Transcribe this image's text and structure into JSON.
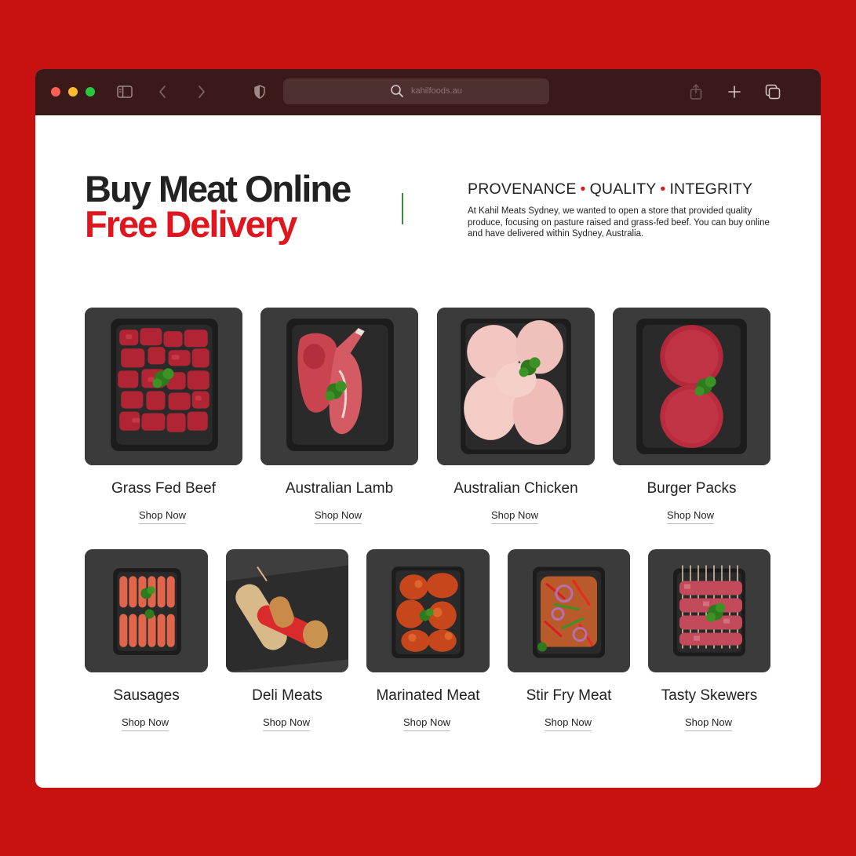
{
  "browser": {
    "url": "kahilfoods.au"
  },
  "hero": {
    "line1": "Buy Meat Online",
    "line2": "Free Delivery",
    "tagline": [
      "PROVENANCE",
      "QUALITY",
      "INTEGRITY"
    ],
    "intro": "At Kahil Meats Sydney, we wanted to open a store that provided quality produce, focusing on pasture raised and grass-fed beef. You can buy online and have delivered within Sydney, Australia."
  },
  "colors": {
    "brand_red": "#e0161e",
    "background_red": "#c81111",
    "titlebar": "#3a1a19",
    "divider_green": "#3b8c43"
  },
  "products_row1": [
    {
      "title": "Grass Fed Beef",
      "link": "Shop Now",
      "icon": "beef-tray-image"
    },
    {
      "title": "Australian Lamb",
      "link": "Shop Now",
      "icon": "lamb-tray-image"
    },
    {
      "title": "Australian Chicken",
      "link": "Shop Now",
      "icon": "chicken-tray-image"
    },
    {
      "title": "Burger Packs",
      "link": "Shop Now",
      "icon": "burger-tray-image"
    }
  ],
  "products_row2": [
    {
      "title": "Sausages",
      "link": "Shop Now",
      "icon": "sausage-tray-image"
    },
    {
      "title": "Deli Meats",
      "link": "Shop Now",
      "icon": "deli-meats-image"
    },
    {
      "title": "Marinated Meat",
      "link": "Shop Now",
      "icon": "marinated-tray-image"
    },
    {
      "title": "Stir Fry Meat",
      "link": "Shop Now",
      "icon": "stirfry-tray-image"
    },
    {
      "title": "Tasty Skewers",
      "link": "Shop Now",
      "icon": "skewers-tray-image"
    }
  ]
}
